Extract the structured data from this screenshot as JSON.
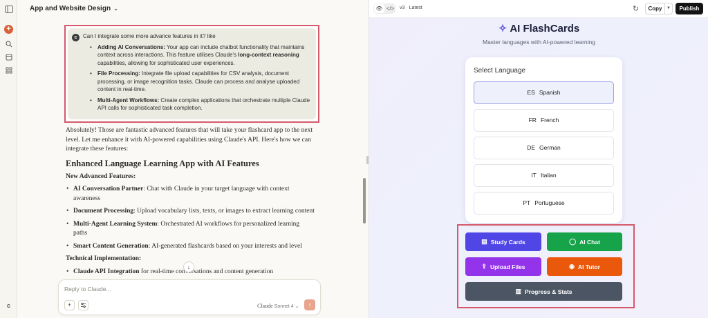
{
  "rail": {
    "new_icon": "+",
    "user_initial": "c"
  },
  "chat": {
    "title": "App and Website Design",
    "user_message": {
      "avatar": "c",
      "intro": "Can I integrate some more advance features in it? like",
      "items": [
        {
          "bold": "Adding AI Conversations:",
          "text": " Your app can include chatbot functionality that maintains context across interactions. This feature utilises Claude's ",
          "bold2": "long-context reasoning",
          "text2": " capabilities, allowing for sophisticated user experiences."
        },
        {
          "bold": "File Processing:",
          "text": " Integrate file upload capabilities for CSV analysis, document processing, or image recognition tasks. Claude can process and analyse uploaded content in real-time.",
          "bold2": "",
          "text2": ""
        },
        {
          "bold": "Multi-Agent Workflows:",
          "text": " Create complex applications that orchestrate multiple Claude API calls for sophisticated task completion.",
          "bold2": "",
          "text2": ""
        }
      ]
    },
    "response": {
      "intro": "Absolutely! Those are fantastic advanced features that will take your flashcard app to the next level. Let me enhance it with AI-powered capabilities using Claude's API. Here's how we can integrate these features:",
      "heading": "Enhanced Language Learning App with AI Features",
      "features_heading": "New Advanced Features:",
      "features": [
        {
          "bold": "AI Conversation Partner",
          "text": ": Chat with Claude in your target language with context awareness"
        },
        {
          "bold": "Document Processing",
          "text": ": Upload vocabulary lists, texts, or images to extract learning content"
        },
        {
          "bold": "Multi-Agent Learning System",
          "text": ": Orchestrated AI workflows for personalized learning paths"
        },
        {
          "bold": "Smart Content Generation",
          "text": ": AI-generated flashcards based on your interests and level"
        }
      ],
      "tech_heading": "Technical Implementation:",
      "tech": [
        {
          "bold": "Claude API Integration",
          "text": " for real-time conversations and content generation"
        }
      ]
    },
    "composer": {
      "placeholder": "Reply to Claude...",
      "model": "Claude",
      "model_version": "Sonnet 4"
    }
  },
  "artifact": {
    "toolbar": {
      "version": "v3 · Latest",
      "copy_label": "Copy",
      "publish_label": "Publish"
    },
    "app_title": "AI FlashCards",
    "app_subtitle": "Master languages with AI-powered learning",
    "select_language_label": "Select Language",
    "languages": [
      {
        "code": "ES",
        "name": "Spanish",
        "selected": true
      },
      {
        "code": "FR",
        "name": "French",
        "selected": false
      },
      {
        "code": "DE",
        "name": "German",
        "selected": false
      },
      {
        "code": "IT",
        "name": "Italian",
        "selected": false
      },
      {
        "code": "PT",
        "name": "Portuguese",
        "selected": false
      }
    ],
    "actions": {
      "study_cards": "Study Cards",
      "ai_chat": "AI Chat",
      "upload_files": "Upload Files",
      "ai_tutor": "AI Tutor",
      "progress_stats": "Progress & Stats"
    },
    "colors": {
      "study_cards": "#4f46e5",
      "ai_chat": "#16a34a",
      "upload_files": "#9333ea",
      "ai_tutor": "#ea580c",
      "progress_stats": "#4b5563",
      "highlight_border": "#d4596a"
    }
  }
}
